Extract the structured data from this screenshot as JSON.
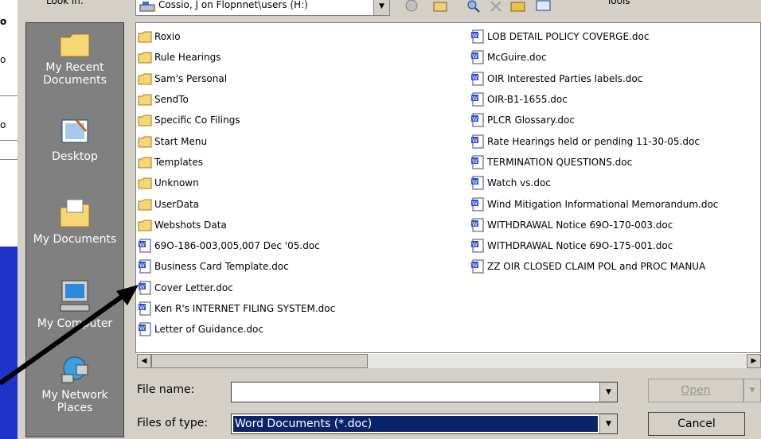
{
  "background_fragments": [
    "o",
    "o",
    "o"
  ],
  "toolbar": {
    "look_in_label": "Look in:",
    "look_in_value": "Cossio, J on Flopnnet\\users (H:)",
    "tools_label": "Tools"
  },
  "places": [
    {
      "label_line1": "My Recent",
      "label_line2": "Documents",
      "icon": "folder-icon"
    },
    {
      "label_line1": "Desktop",
      "label_line2": "",
      "icon": "desktop-icon"
    },
    {
      "label_line1": "My Documents",
      "label_line2": "",
      "icon": "my-documents-icon"
    },
    {
      "label_line1": "My Computer",
      "label_line2": "",
      "icon": "computer-icon"
    },
    {
      "label_line1": "My Network",
      "label_line2": "Places",
      "icon": "network-icon"
    }
  ],
  "files_col1": [
    {
      "name": "Roxio",
      "type": "folder"
    },
    {
      "name": "Rule Hearings",
      "type": "folder"
    },
    {
      "name": "Sam's Personal",
      "type": "folder"
    },
    {
      "name": "SendTo",
      "type": "folder"
    },
    {
      "name": "Specific Co Filings",
      "type": "folder"
    },
    {
      "name": "Start Menu",
      "type": "folder"
    },
    {
      "name": "Templates",
      "type": "folder"
    },
    {
      "name": "Unknown",
      "type": "folder"
    },
    {
      "name": "UserData",
      "type": "folder"
    },
    {
      "name": "Webshots Data",
      "type": "folder"
    },
    {
      "name": "69O-186-003,005,007 Dec '05.doc",
      "type": "doc"
    },
    {
      "name": "Business Card Template.doc",
      "type": "doc"
    },
    {
      "name": "Cover Letter.doc",
      "type": "doc"
    },
    {
      "name": "Ken R's INTERNET FILING SYSTEM.doc",
      "type": "doc"
    },
    {
      "name": "Letter of Guidance.doc",
      "type": "doc"
    }
  ],
  "files_col2": [
    {
      "name": "LOB DETAIL POLICY COVERGE.doc",
      "type": "doc"
    },
    {
      "name": "McGuire.doc",
      "type": "doc"
    },
    {
      "name": "OIR Interested Parties labels.doc",
      "type": "doc"
    },
    {
      "name": "OIR-B1-1655.doc",
      "type": "doc"
    },
    {
      "name": "PLCR Glossary.doc",
      "type": "doc"
    },
    {
      "name": "Rate Hearings held or pending 11-30-05.doc",
      "type": "doc"
    },
    {
      "name": "TERMINATION QUESTIONS.doc",
      "type": "doc"
    },
    {
      "name": "Watch vs.doc",
      "type": "doc"
    },
    {
      "name": "Wind Mitigation Informational Memorandum.doc",
      "type": "doc"
    },
    {
      "name": "WITHDRAWAL Notice 69O-170-003.doc",
      "type": "doc"
    },
    {
      "name": "WITHDRAWAL Notice 69O-175-001.doc",
      "type": "doc"
    },
    {
      "name": "ZZ OIR CLOSED CLAIM POL and PROC MANUA",
      "type": "doc"
    }
  ],
  "footer": {
    "file_name_label": "File name:",
    "file_name_value": "",
    "files_of_type_label": "Files of type:",
    "files_of_type_value": "Word Documents (*.doc)",
    "open_label": "Open",
    "cancel_label": "Cancel"
  },
  "colors": {
    "background": "#1f33c8",
    "dialog": "#d4d0c8",
    "selection": "#0a246a",
    "places_bar": "#808080"
  }
}
